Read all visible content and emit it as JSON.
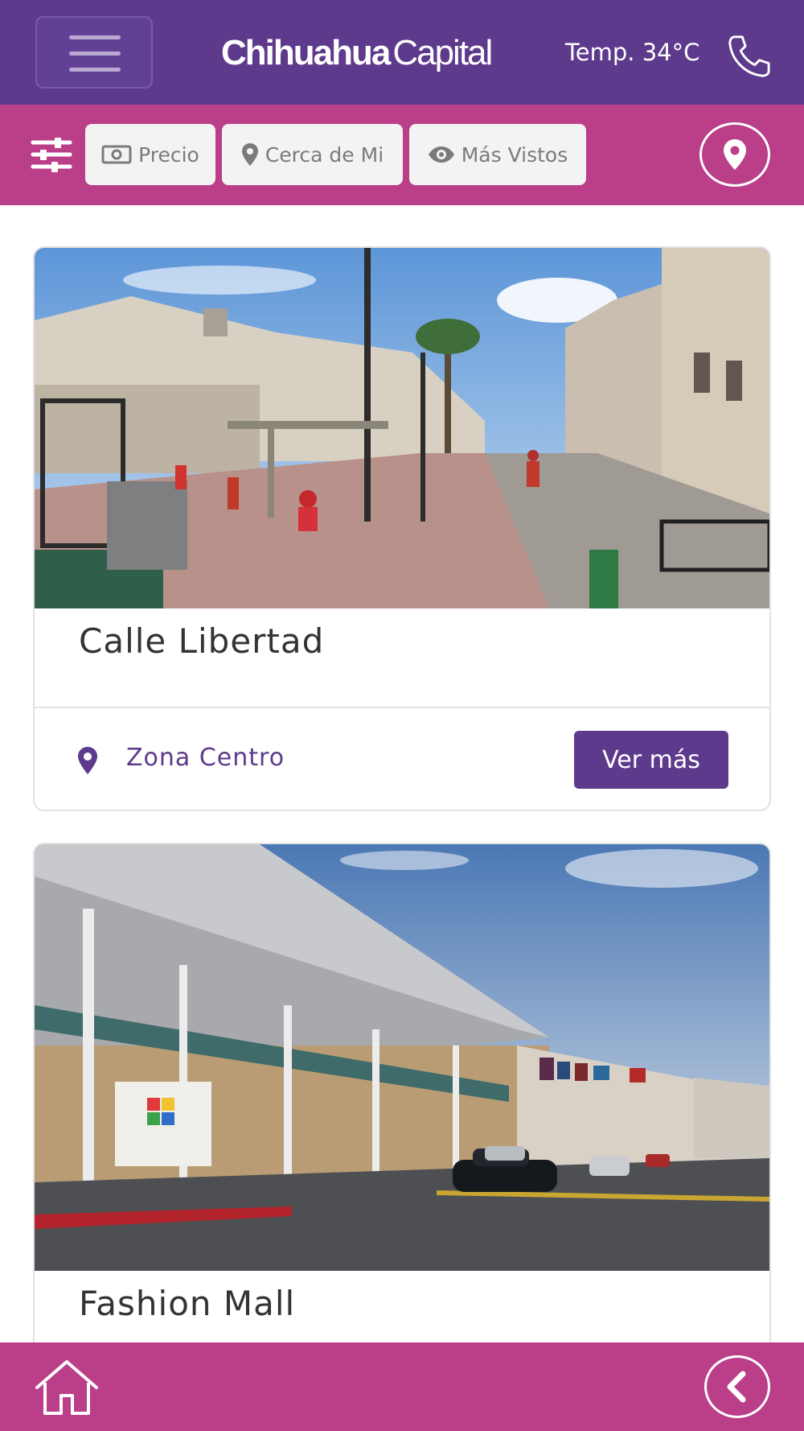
{
  "header": {
    "logo_bold": "Chihuahua",
    "logo_light": "Capital",
    "temperature": "Temp. 34°C",
    "icons": {
      "menu": "hamburger-menu-icon",
      "phone": "phone-icon"
    }
  },
  "filters": {
    "icon": "sliders-icon",
    "chips": [
      {
        "label": "Precio",
        "icon": "money-bill-icon"
      },
      {
        "label": "Cerca de Mi",
        "icon": "map-pin-icon"
      },
      {
        "label": "Más Vistos",
        "icon": "eye-icon"
      }
    ],
    "map_icon": "map-pin-icon"
  },
  "places": [
    {
      "name": "Calle Libertad",
      "zone": "Zona Centro",
      "button": "Ver más"
    },
    {
      "name": "Fashion Mall"
    }
  ],
  "bottom": {
    "home_icon": "home-icon",
    "back_icon": "chevron-left-icon"
  },
  "colors": {
    "header_purple": "#5e3a8c",
    "accent_pink": "#bb3e89",
    "chip_bg": "#f3f3f3",
    "chip_text": "#7b7b7b"
  }
}
